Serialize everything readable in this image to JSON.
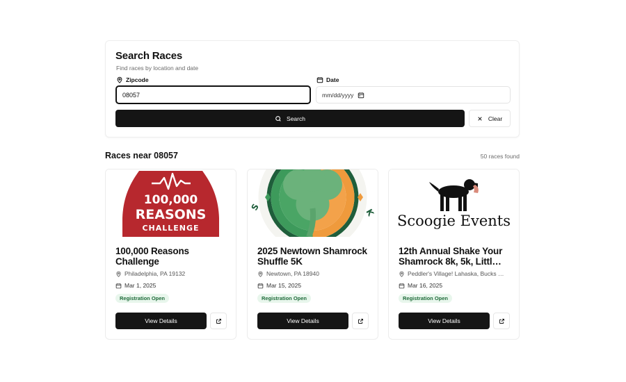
{
  "search": {
    "title": "Search Races",
    "subtitle": "Find races by location and date",
    "zip_label": "Zipcode",
    "zip_value": "08057",
    "date_label": "Date",
    "date_placeholder": "mm/dd/yyyy",
    "search_label": "Search",
    "clear_label": "Clear"
  },
  "results": {
    "heading": "Races near 08057",
    "count": "50 races found"
  },
  "races": [
    {
      "name": "100,000 Reasons Challenge",
      "location": "Philadelphia, PA 19132",
      "date": "Mar 1, 2025",
      "status": "Registration Open",
      "view_label": "View Details",
      "logo": {
        "line1": "100,000",
        "line2": "REASONS",
        "line3": "CHALLENGE",
        "color": "#b7282e"
      }
    },
    {
      "name": "2025 Newtown Shamrock Shuffle 5K",
      "location": "Newtown, PA 18940",
      "date": "Mar 15, 2025",
      "status": "Registration Open",
      "view_label": "View Details",
      "logo": {
        "green": "#3d9a5b",
        "orange": "#ef9a3c",
        "dark": "#1f5e3b"
      }
    },
    {
      "name": "12th Annual Shake Your Shamrock 8k, 5k, Littl…",
      "location": "Peddler's Village! Lahaska, Bucks …",
      "date": "Mar 16, 2025",
      "status": "Registration Open",
      "view_label": "View Details",
      "logo": {
        "text": "Scoogie Events"
      }
    }
  ],
  "colors": {
    "primary_button": "#151515",
    "badge_bg": "#e8f6ec",
    "badge_text": "#1f6b3a"
  }
}
